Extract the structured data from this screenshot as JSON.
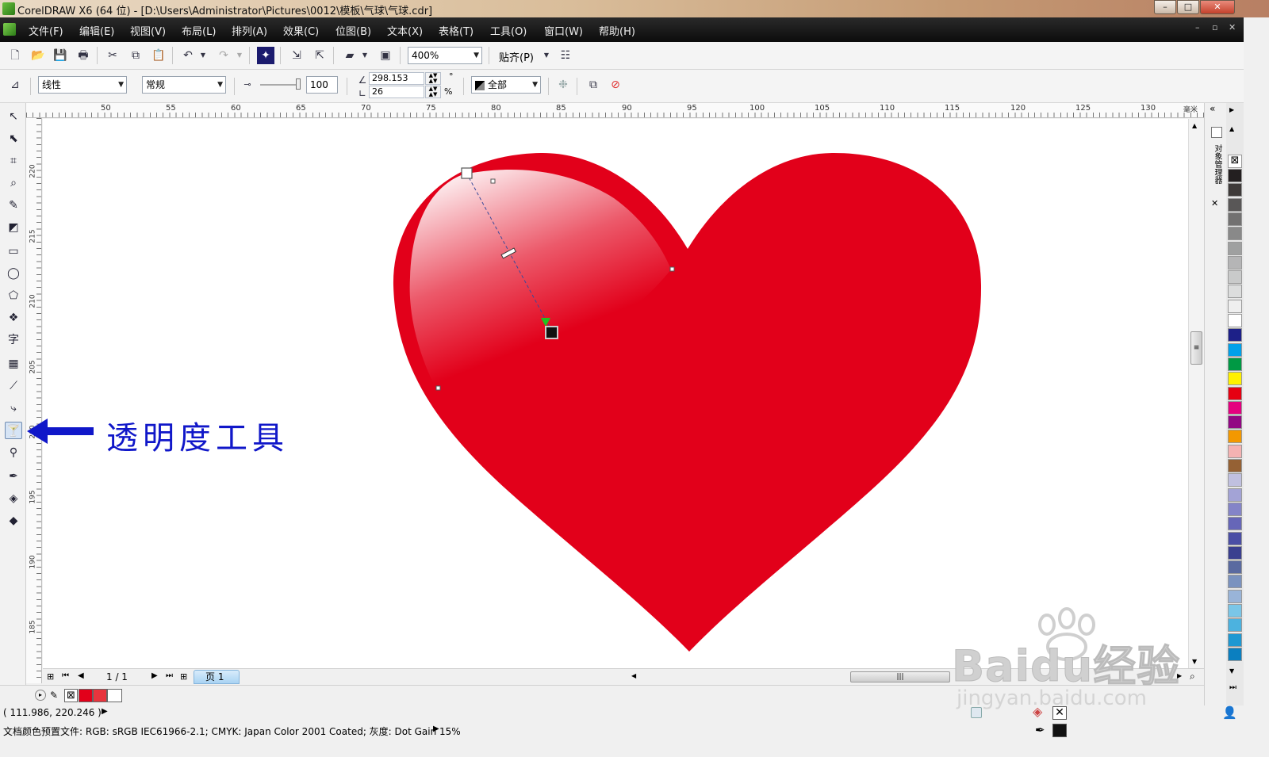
{
  "window": {
    "title": "CorelDRAW X6 (64 位) - [D:\\Users\\Administrator\\Pictures\\0012\\模板\\气球\\气球.cdr]",
    "min": "–",
    "max": "□",
    "close": "✕"
  },
  "menu": [
    "文件(F)",
    "编辑(E)",
    "视图(V)",
    "布局(L)",
    "排列(A)",
    "效果(C)",
    "位图(B)",
    "文本(X)",
    "表格(T)",
    "工具(O)",
    "窗口(W)",
    "帮助(H)"
  ],
  "mdi_controls": [
    "–",
    "▫",
    "✕"
  ],
  "toolbar": {
    "zoom": "400%",
    "snap": "贴齐(P)"
  },
  "propbar": {
    "transparency_type": "线性",
    "merge_mode": "常规",
    "opacity": "100",
    "angle": "298.153",
    "edge": "26",
    "angle_unit": "°",
    "edge_unit": "%",
    "apply_to": "全部"
  },
  "ruler": {
    "top": [
      "50",
      "55",
      "60",
      "65",
      "70",
      "75",
      "80",
      "85",
      "90",
      "95",
      "100",
      "105",
      "110",
      "115",
      "120",
      "125",
      "130"
    ],
    "unit": "毫米",
    "left": [
      "220",
      "215",
      "210",
      "205",
      "200",
      "195",
      "190",
      "185"
    ]
  },
  "pagenav": {
    "counter": "1 / 1",
    "tab": "页 1"
  },
  "status": {
    "coords": "( 111.986, 220.246 )",
    "color_profile": "文档颜色预置文件: RGB: sRGB IEC61966-2.1; CMYK: Japan Color 2001 Coated; 灰度: Dot Gain 15%"
  },
  "annotation": {
    "label": "透明度工具",
    "color": "#1017c9"
  },
  "colors": {
    "heart": "#e2001a",
    "selected_fill": "#e2001a"
  },
  "docker": {
    "label": "对象管理器"
  },
  "watermark": {
    "brand": "Baidu经验",
    "url": "jingyan.baidu.com"
  },
  "palette": [
    "#231f20",
    "#3e3a39",
    "#595757",
    "#727171",
    "#898989",
    "#9fa0a0",
    "#b5b5b6",
    "#c9caca",
    "#dcdddd",
    "#efefef",
    "#ffffff",
    "#1d2088",
    "#00a0e9",
    "#009944",
    "#fff100",
    "#e60012",
    "#e4007f",
    "#920783",
    "#f39800",
    "#f5b2b2",
    "#956134",
    "#c0c0e0",
    "#a3a3d6",
    "#8484c8",
    "#6666b8",
    "#4a4ea5",
    "#3a3f8f",
    "#5a6aa0",
    "#7a92bf",
    "#99b4d8",
    "#7ac6e8",
    "#4cb2df",
    "#1e98d2",
    "#0b7fc0"
  ]
}
